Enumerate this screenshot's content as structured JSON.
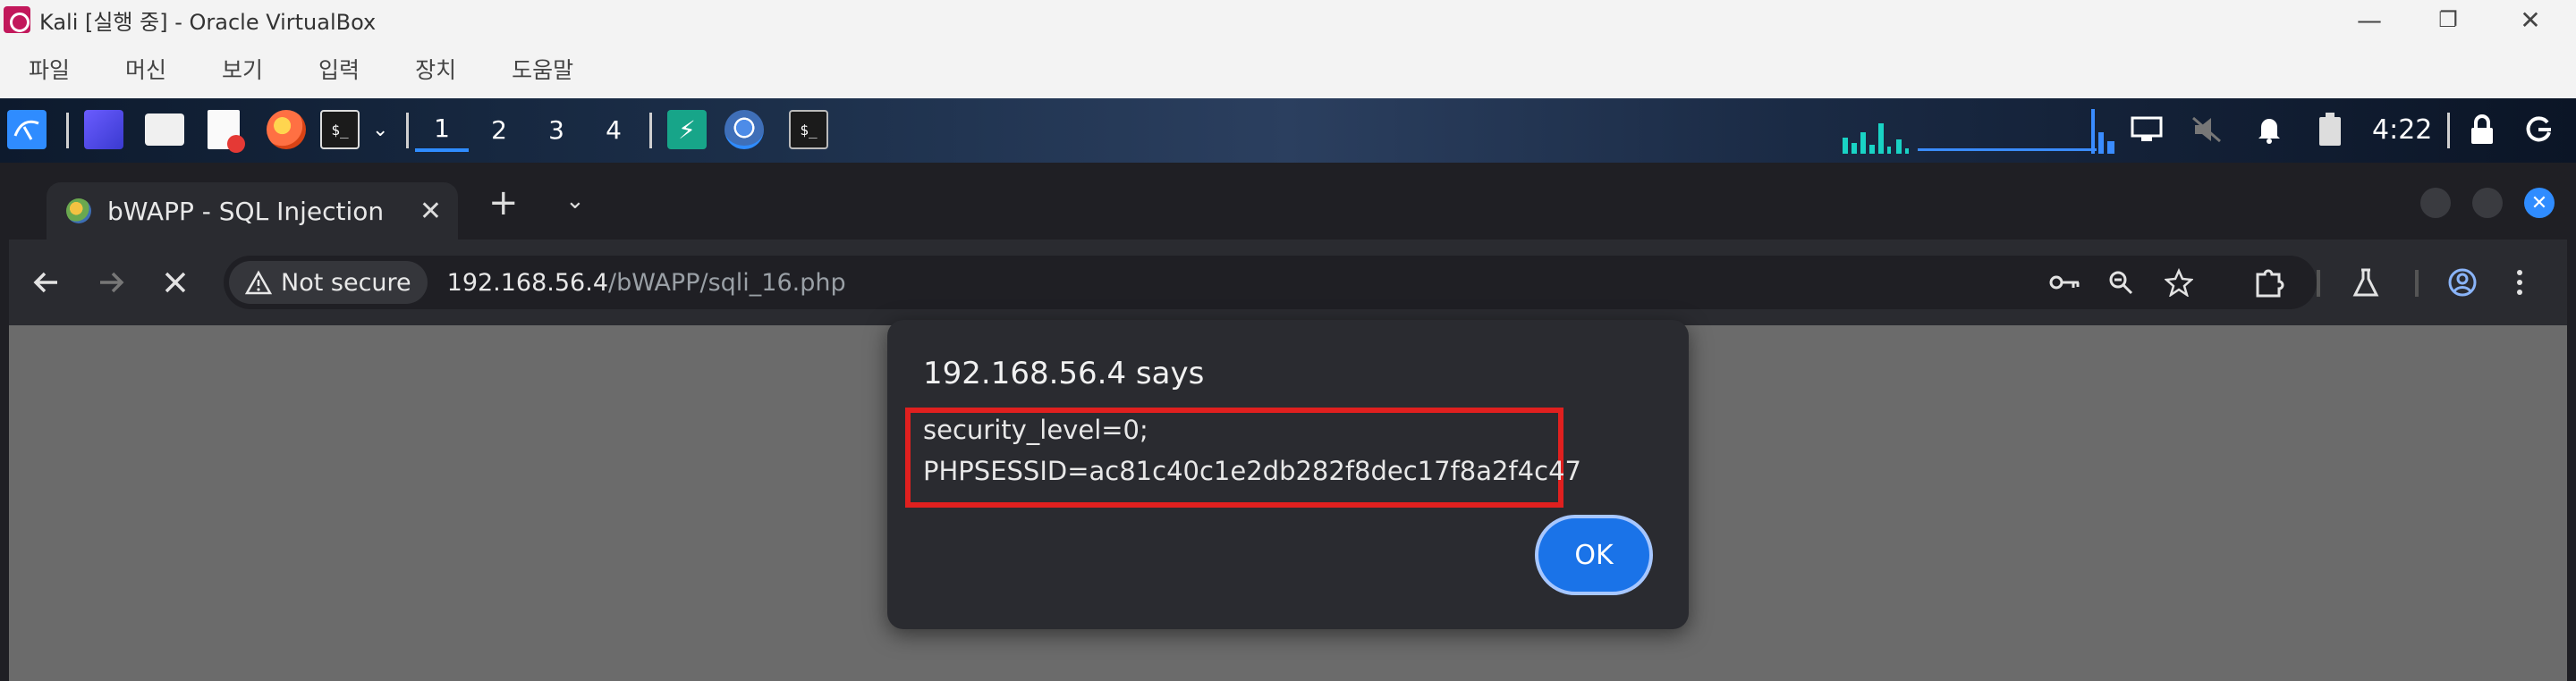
{
  "vbox": {
    "window_title": "Kali [실행 중] - Oracle VirtualBox",
    "menu": [
      "파일",
      "머신",
      "보기",
      "입력",
      "장치",
      "도움말"
    ],
    "controls": {
      "minimize": "—",
      "restore": "❐",
      "close": "✕"
    }
  },
  "kali_panel": {
    "workspaces": [
      "1",
      "2",
      "3",
      "4"
    ],
    "active_workspace": "1",
    "terminal_glyph": "$_",
    "clock": "4:22"
  },
  "browser": {
    "tab_title": "bWAPP - SQL Injection",
    "tab_close": "✕",
    "new_tab": "+",
    "tab_search": "⌄",
    "not_secure_label": "Not secure",
    "url_host": "192.168.56.4",
    "url_path": "/bWAPP/sqli_16.php",
    "accent_color": "#2f8cff"
  },
  "dialog": {
    "title": "192.168.56.4 says",
    "line1": "security_level=0;",
    "line2": "PHPSESSID=ac81c40c1e2db282f8dec17f8a2f4c47",
    "ok_label": "OK",
    "highlight_color": "#e0201f"
  }
}
